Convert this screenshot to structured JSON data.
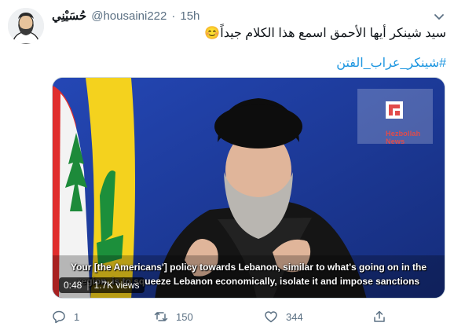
{
  "tweet": {
    "display_name": "حُسَيْنِي",
    "handle": "@housaini222",
    "separator": "·",
    "time": "15h",
    "text": "سيد شينكر أيها الأحمق اسمع هذا الكلام جيداً😊",
    "hashtag": "#شينكر_عراب_الفتن",
    "avatar_icon": "bearded-man-avatar",
    "menu_icon": "chevron-down-icon"
  },
  "media": {
    "subtitles": [
      "Your [the Americans'] policy towards Lebanon, similar to what's going on in the",
      "region, is to squeeze Lebanon economically, isolate it and impose sanctions"
    ],
    "overlay_logo_text": "Hezbollah News",
    "duration": "0:48",
    "views": "1.7K views",
    "badge_separator": "|"
  },
  "actions": {
    "reply": {
      "icon": "reply-icon",
      "count": "1"
    },
    "retweet": {
      "icon": "retweet-icon",
      "count": "150"
    },
    "like": {
      "icon": "heart-icon",
      "count": "344"
    },
    "share": {
      "icon": "share-icon"
    }
  },
  "colors": {
    "link": "#1b95e0",
    "secondary": "#5b7083",
    "video_bg": "#1f3a9c",
    "flag_yellow": "#f4d21e",
    "flag_red": "#e02d2d"
  }
}
